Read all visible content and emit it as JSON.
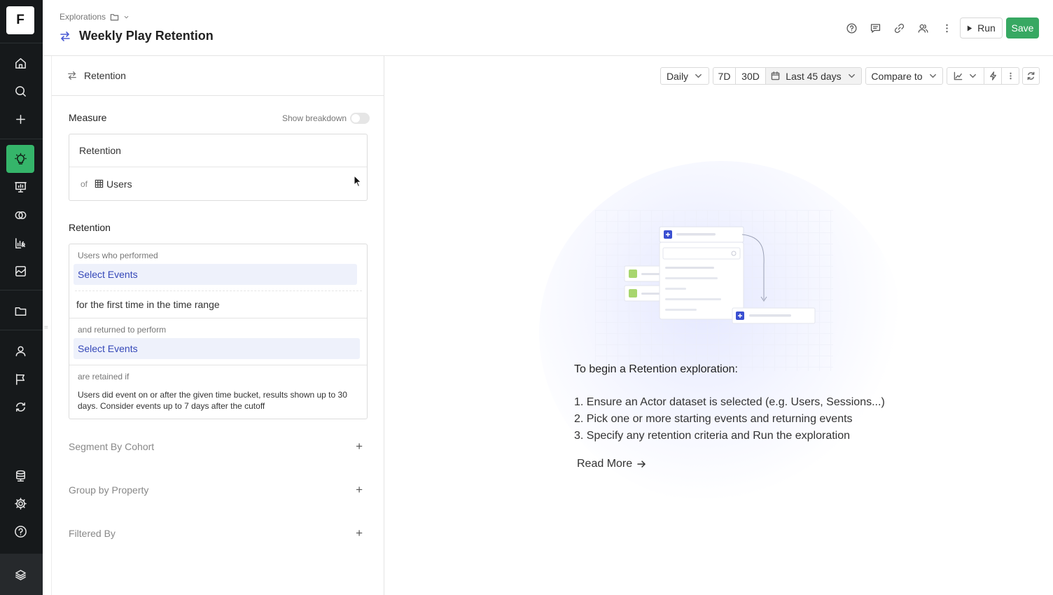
{
  "app": {
    "logo_letter": "F"
  },
  "sidebar": {
    "items": [
      {
        "name": "home-icon"
      },
      {
        "name": "search-icon"
      },
      {
        "name": "plus-icon"
      },
      {
        "name": "lightbulb-icon",
        "active": true
      },
      {
        "name": "presentation-icon"
      },
      {
        "name": "venn-icon"
      },
      {
        "name": "metrics-icon"
      },
      {
        "name": "image-chart-icon"
      },
      {
        "name": "folder-icon"
      },
      {
        "name": "user-icon"
      },
      {
        "name": "flag-icon"
      },
      {
        "name": "sync-icon"
      },
      {
        "name": "database-icon"
      },
      {
        "name": "gear-icon"
      },
      {
        "name": "help-icon"
      },
      {
        "name": "stack-logo-icon"
      }
    ],
    "active_color": "#35b56a"
  },
  "header": {
    "breadcrumb": "Explorations",
    "title": "Weekly Play Retention",
    "run_label": "Run",
    "save_label": "Save",
    "save_color": "#37a862"
  },
  "panel": {
    "head_label": "Retention",
    "measure": {
      "label": "Measure",
      "show_breakdown": "Show breakdown",
      "metric": "Retention",
      "of_label": "of",
      "dataset": "Users"
    },
    "retention": {
      "label": "Retention",
      "performed_label": "Users who performed",
      "select_events_1": "Select Events",
      "first_time": "for the first time in the time range",
      "returned_label": "and returned to perform",
      "select_events_2": "Select Events",
      "retained_label": "are retained if",
      "retained_desc": "Users did event on or after the given time bucket, results shown up to 30 days. Consider events up to 7 days after the cutoff"
    },
    "segment_by_cohort": "Segment By Cohort",
    "group_by_property": "Group by Property",
    "filtered_by": "Filtered By"
  },
  "toolbar": {
    "granularity": "Daily",
    "range_7d": "7D",
    "range_30d": "30D",
    "date_range": "Last 45 days",
    "compare": "Compare to"
  },
  "empty_state": {
    "intro": "To begin a Retention exploration:",
    "step1": "1. Ensure an Actor dataset is selected (e.g. Users, Sessions...)",
    "step2": "2. Pick one or more starting events and returning events",
    "step3": "3. Specify any retention criteria and Run the exploration",
    "read_more": "Read More"
  }
}
